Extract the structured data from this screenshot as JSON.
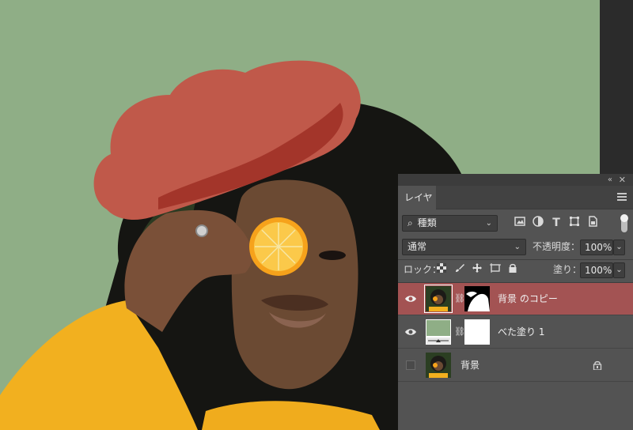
{
  "panel": {
    "tab_label": "レイヤー",
    "filter_label": "種類",
    "blend_mode": "通常",
    "opacity_label": "不透明度：",
    "opacity_value": "100%",
    "lock_label": "ロック：",
    "fill_label": "塗り：",
    "fill_value": "100%"
  },
  "layers": [
    {
      "name": "背景 のコピー",
      "visible": true,
      "selected": true
    },
    {
      "name": "べた塗り 1",
      "visible": true,
      "selected": false
    },
    {
      "name": "背景",
      "visible": false,
      "selected": false,
      "locked": true
    }
  ],
  "colors": {
    "canvas_background": "#8fae86",
    "mask_overlay": "#c0594a",
    "sweater": "#f2b01f",
    "selected_layer": "#a35353",
    "panel": "#535353"
  },
  "icons": [
    "search-icon",
    "image-filter-icon",
    "adjustment-filter-icon",
    "type-filter-icon",
    "shape-filter-icon",
    "smart-object-filter-icon",
    "lock-pixels-icon",
    "lock-paint-icon",
    "lock-position-icon",
    "lock-artboard-icon",
    "lock-all-icon",
    "eye-icon",
    "link-icon",
    "lock-icon",
    "panel-menu-icon",
    "close-icon",
    "collapse-icon"
  ]
}
